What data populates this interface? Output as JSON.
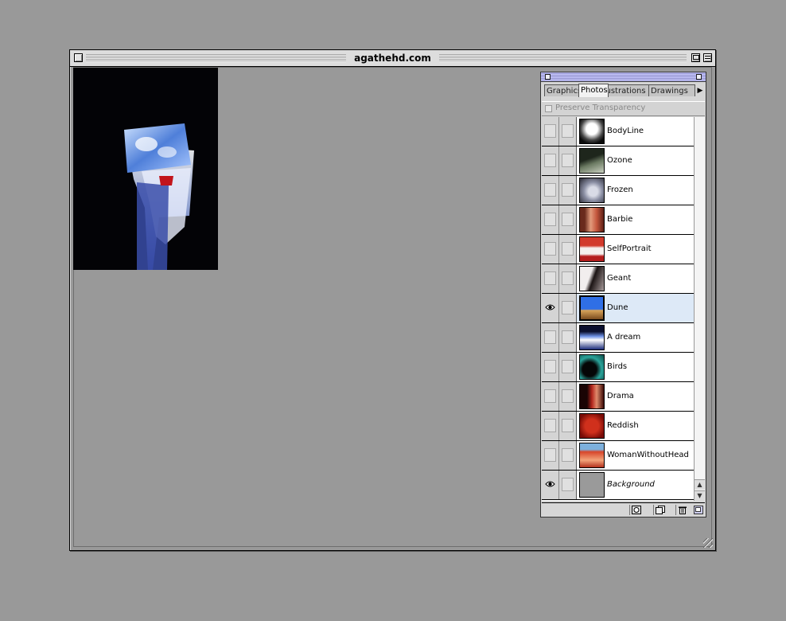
{
  "window": {
    "title": "agathehd.com"
  },
  "palette": {
    "tabs": [
      {
        "label": "Graphics",
        "active": false
      },
      {
        "label": "Photos",
        "active": true
      },
      {
        "label": "Illustrations",
        "active": false
      },
      {
        "label": "Drawings",
        "active": false
      }
    ],
    "preserve_transparency": "Preserve Transparency",
    "layers": [
      {
        "name": "BodyLine",
        "visible": false,
        "selected": false,
        "italic": false
      },
      {
        "name": "Ozone",
        "visible": false,
        "selected": false,
        "italic": false
      },
      {
        "name": "Frozen",
        "visible": false,
        "selected": false,
        "italic": false
      },
      {
        "name": "Barbie",
        "visible": false,
        "selected": false,
        "italic": false
      },
      {
        "name": "SelfPortrait",
        "visible": false,
        "selected": false,
        "italic": false
      },
      {
        "name": "Geant",
        "visible": false,
        "selected": false,
        "italic": false
      },
      {
        "name": "Dune",
        "visible": true,
        "selected": true,
        "italic": false
      },
      {
        "name": "A dream",
        "visible": false,
        "selected": false,
        "italic": false
      },
      {
        "name": "Birds",
        "visible": false,
        "selected": false,
        "italic": false
      },
      {
        "name": "Drama",
        "visible": false,
        "selected": false,
        "italic": false
      },
      {
        "name": "Reddish",
        "visible": false,
        "selected": false,
        "italic": false
      },
      {
        "name": "WomanWithoutHead",
        "visible": false,
        "selected": false,
        "italic": false
      },
      {
        "name": "Background",
        "visible": true,
        "selected": false,
        "italic": true
      }
    ],
    "footer_icons": [
      "mask-icon",
      "new-layer-icon",
      "trash-icon",
      "resize-icon"
    ]
  },
  "colors": {
    "desktop": "#999999",
    "selected_row": "#dde9f7",
    "palette_titlebar": "#9999cc"
  }
}
